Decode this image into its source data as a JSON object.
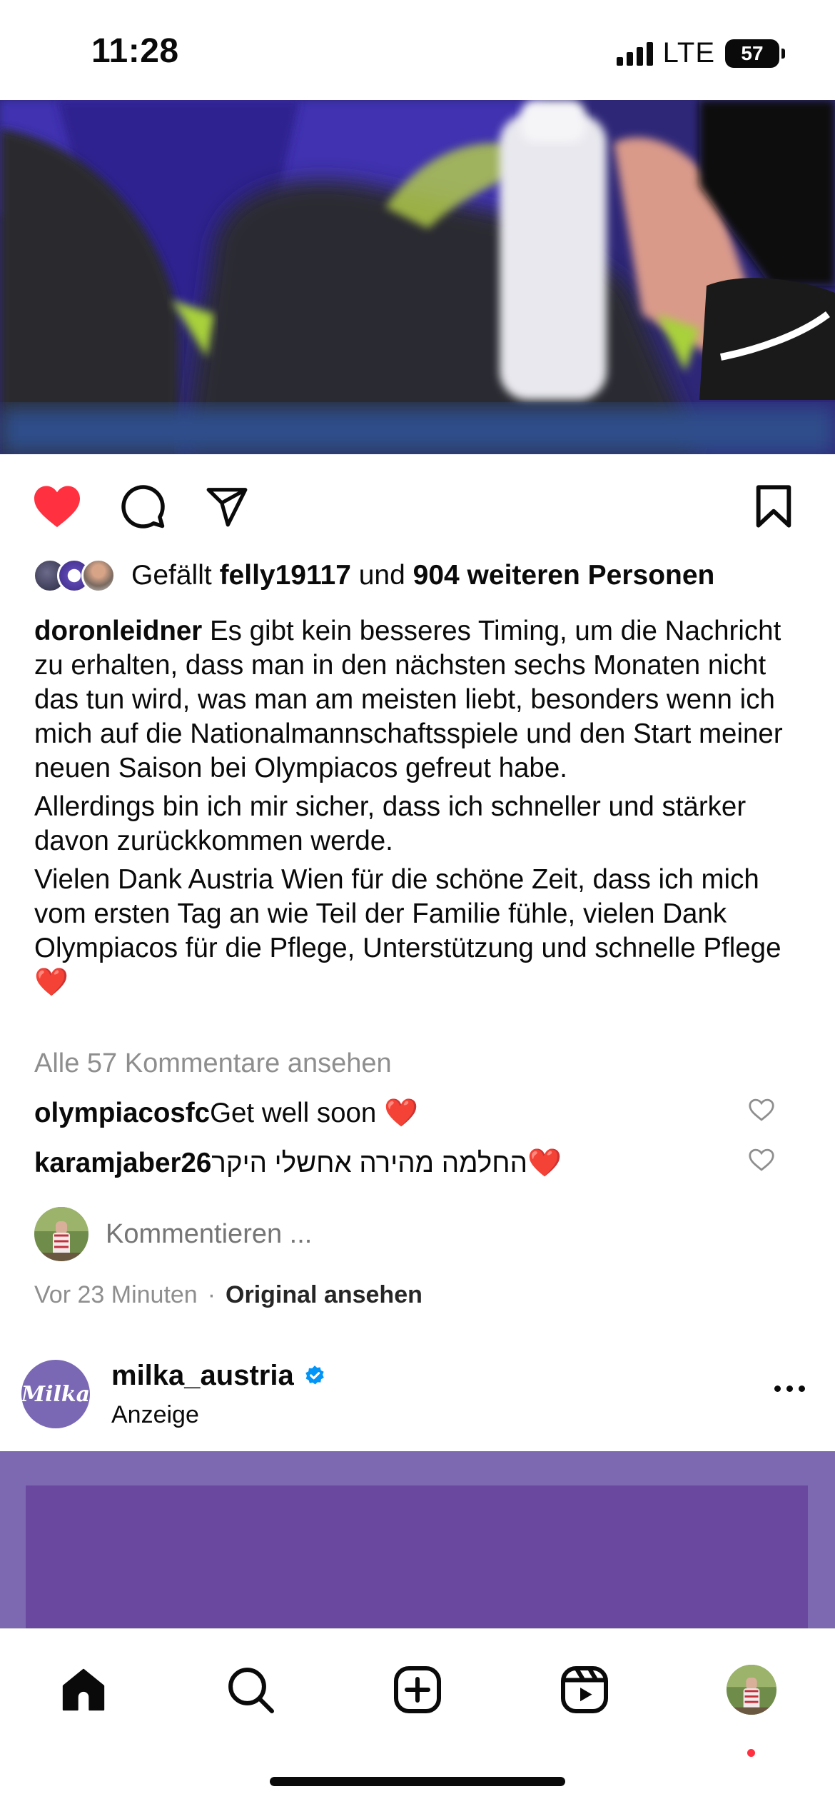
{
  "status_bar": {
    "time": "11:28",
    "network": "LTE",
    "battery": "57"
  },
  "post": {
    "liked": true,
    "likes": {
      "prefix": "Gefällt ",
      "first_user": "felly19117",
      "connector": " und ",
      "others": "904 weiteren Personen"
    },
    "caption": {
      "username": "doronleidner",
      "paragraph1": " Es gibt kein besseres Timing, um die Nachricht zu erhalten, dass man in den nächsten sechs Monaten nicht das tun wird, was man am meisten liebt, besonders wenn ich mich auf die Nationalmannschaftsspiele und den Start meiner neuen Saison bei Olympiacos gefreut habe.",
      "paragraph2": "Allerdings bin ich mir sicher, dass ich schneller und stärker davon zurückkommen werde.",
      "paragraph3": "Vielen Dank Austria Wien für die schöne Zeit, dass ich mich vom ersten Tag an wie Teil der Familie fühle, vielen Dank Olympiacos für die Pflege, Unterstützung und schnelle Pflege❤️"
    },
    "view_comments": "Alle 57 Kommentare ansehen",
    "comments": [
      {
        "username": "olympiacosfc",
        "text": " Get well soon ❤️"
      },
      {
        "username": "karamjaber26",
        "text": " החלמה מהירה אחשלי היקר❤️"
      }
    ],
    "add_comment_placeholder": "Kommentieren ...",
    "timestamp": "Vor 23 Minuten",
    "separator": "·",
    "original_link": "Original ansehen"
  },
  "next_post": {
    "username": "milka_austria",
    "verified": true,
    "subtitle": "Anzeige",
    "avatar_text": "Milka"
  },
  "colors": {
    "like_red": "#ff3040",
    "verified_blue": "#0095f6",
    "milka_purple": "#7c69b2"
  },
  "tab_bar": {
    "items": [
      "home-icon",
      "search-icon",
      "create-icon",
      "reels-icon",
      "profile-avatar"
    ]
  }
}
